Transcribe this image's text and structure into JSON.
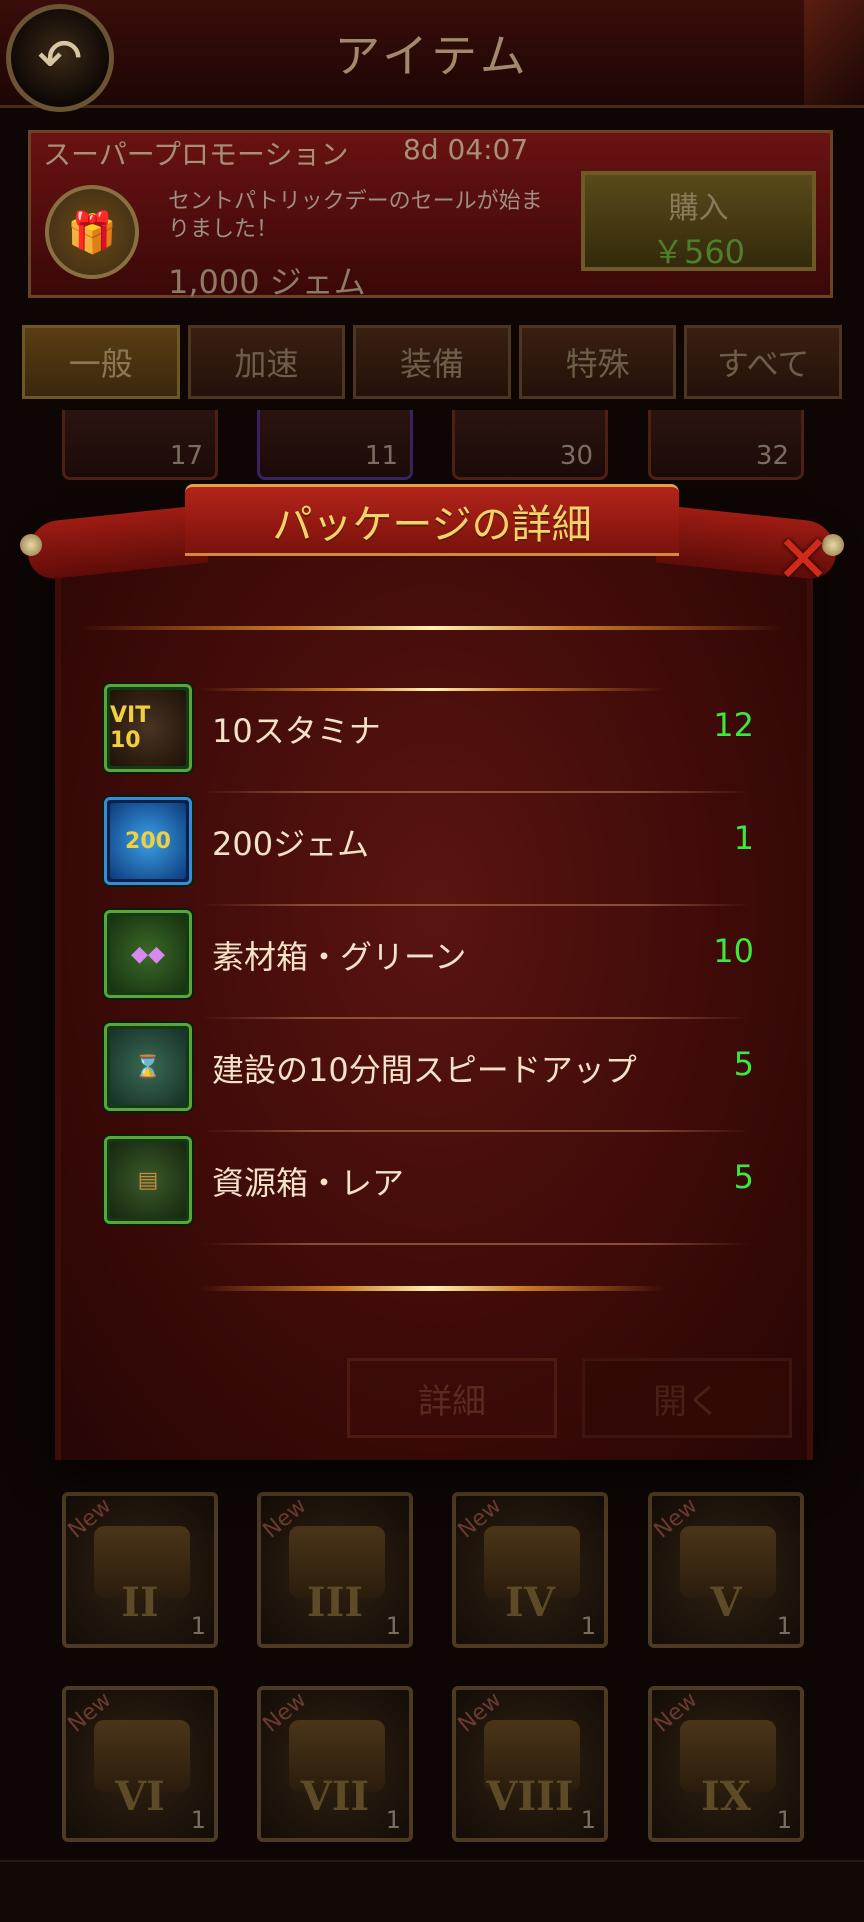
{
  "header": {
    "title": "アイテム"
  },
  "promo": {
    "title": "スーパープロモーション",
    "timer": "8d 04:07",
    "description": "セントパトリックデーのセールが始まりました！",
    "gems": "1,000 ジェム",
    "buy_label": "購入",
    "buy_price": "￥560"
  },
  "tabs": [
    {
      "label": "一般",
      "active": true
    },
    {
      "label": "加速"
    },
    {
      "label": "装備"
    },
    {
      "label": "特殊"
    },
    {
      "label": "すべて"
    }
  ],
  "top_slots": [
    "17",
    "11",
    "30",
    "32"
  ],
  "chest_slots": [
    {
      "new": "New",
      "roman": "II",
      "count": "1"
    },
    {
      "new": "New",
      "roman": "III",
      "count": "1"
    },
    {
      "new": "New",
      "roman": "IV",
      "count": "1"
    },
    {
      "new": "New",
      "roman": "V",
      "count": "1"
    },
    {
      "new": "New",
      "roman": "VI",
      "count": "1"
    },
    {
      "new": "New",
      "roman": "VII",
      "count": "1"
    },
    {
      "new": "New",
      "roman": "VIII",
      "count": "1"
    },
    {
      "new": "New",
      "roman": "IX",
      "count": "1"
    }
  ],
  "modal": {
    "title": "パッケージの詳細",
    "items": [
      {
        "icon": "stamina-icon",
        "icon_text": "VIT 10",
        "name": "10スタミナ",
        "qty": "12"
      },
      {
        "icon": "gem-icon",
        "icon_text": "200",
        "name": "200ジェム",
        "qty": "1"
      },
      {
        "icon": "material-box-icon",
        "icon_text": "",
        "name": "素材箱・グリーン",
        "qty": "10"
      },
      {
        "icon": "hourglass-hammer-icon",
        "icon_text": "",
        "name": "建設の10分間スピードアップ",
        "qty": "5"
      },
      {
        "icon": "resource-box-icon",
        "icon_text": "",
        "name": "資源箱・レア",
        "qty": "5"
      }
    ],
    "detail_button": "詳細",
    "open_button": "開く"
  }
}
